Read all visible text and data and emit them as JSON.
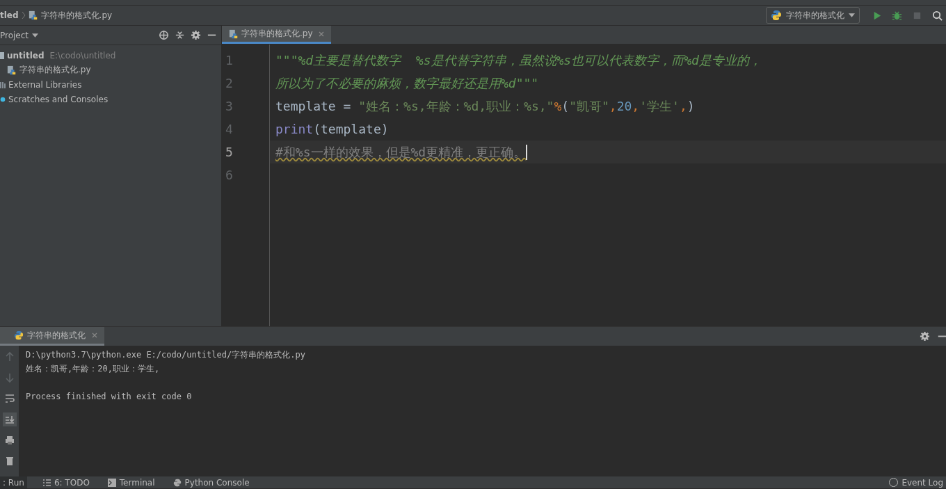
{
  "breadcrumbs": [
    {
      "label": "tled",
      "kind": "project"
    },
    {
      "label": "字符串的格式化.py",
      "kind": "file"
    }
  ],
  "run_config": {
    "label": "字符串的格式化"
  },
  "project_panel": {
    "title": "Project",
    "tree": [
      {
        "label": "untitled",
        "path": "E:\\codo\\untitled",
        "kind": "folder",
        "expanded": true,
        "children": [
          {
            "label": "字符串的格式化.py",
            "kind": "python"
          }
        ]
      },
      {
        "label": "External Libraries",
        "kind": "library"
      },
      {
        "label": "Scratches and Consoles",
        "kind": "scratch"
      }
    ]
  },
  "editor": {
    "tabs": [
      {
        "label": "字符串的格式化.py",
        "selected": true
      }
    ],
    "lines": [
      {
        "number": "1",
        "current": false,
        "tokens": [
          {
            "kind": "doc",
            "text": "\"\"\"%d主要是替代数字  %s是代替字符串，虽然说%s也可以代表数字，而%d是专业的，"
          }
        ]
      },
      {
        "number": "2",
        "current": false,
        "tokens": [
          {
            "kind": "doc",
            "text": "所以为了不必要的麻烦，数字最好还是用%d\"\"\""
          }
        ]
      },
      {
        "number": "3",
        "current": false,
        "tokens": [
          {
            "kind": "plain",
            "text": "template = "
          },
          {
            "kind": "string",
            "text": "\"姓名：%s,年龄：%d,职业：%s,\""
          },
          {
            "kind": "op",
            "text": "%"
          },
          {
            "kind": "plain",
            "text": "("
          },
          {
            "kind": "string",
            "text": "\"凯哥\""
          },
          {
            "kind": "comma",
            "text": ","
          },
          {
            "kind": "number",
            "text": "20"
          },
          {
            "kind": "comma",
            "text": ","
          },
          {
            "kind": "string",
            "text": "'学生'"
          },
          {
            "kind": "comma",
            "text": ","
          },
          {
            "kind": "plain",
            "text": ")"
          }
        ]
      },
      {
        "number": "4",
        "current": false,
        "tokens": [
          {
            "kind": "builtin",
            "text": "print"
          },
          {
            "kind": "plain",
            "text": "(template)"
          }
        ]
      },
      {
        "number": "5",
        "current": true,
        "tokens": [
          {
            "kind": "comment",
            "text": "#和%s一样的效果，但是%d更精准，更正确。"
          }
        ]
      },
      {
        "number": "6",
        "current": false
      }
    ]
  },
  "run_panel": {
    "tabs": [
      {
        "label": "字符串的格式化",
        "selected": true
      }
    ],
    "output": [
      "D:\\python3.7\\python.exe E:/codo/untitled/字符串的格式化.py",
      "姓名：凯哥,年龄：20,职业：学生,"
    ],
    "exit_message": "Process finished with exit code 0"
  },
  "status_bar": {
    "tabs": [
      {
        "label": ": Run",
        "kind": "run",
        "selected": true
      },
      {
        "label": "6: TODO",
        "kind": "todo",
        "selected": false
      },
      {
        "label": "Terminal",
        "kind": "terminal",
        "selected": false
      },
      {
        "label": "Python Console",
        "kind": "console",
        "selected": false
      }
    ],
    "event_log": "Event Log"
  }
}
